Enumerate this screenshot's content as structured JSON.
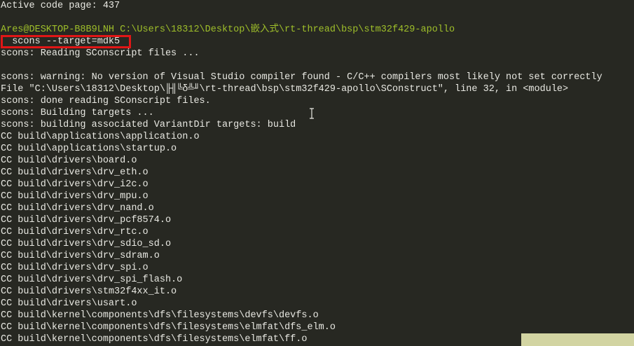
{
  "terminal": {
    "active_code_page": "Active code page: 437",
    "prompt": "Ares@DESKTOP-B8B9LNH C:\\Users\\18312\\Desktop\\嵌入式\\rt-thread\\bsp\\stm32f429-apollo",
    "command": "  scons --target=mdk5",
    "output": [
      "scons: Reading SConscript files ...",
      "scons: warning: No version of Visual Studio compiler found - C/C++ compilers most likely not set correctly",
      "File \"C:\\Users\\18312\\Desktop\\╟╢╚δ╩╜\\rt-thread\\bsp\\stm32f429-apollo\\SConstruct\", line 32, in <module>",
      "scons: done reading SConscript files.",
      "scons: Building targets ...",
      "scons: building associated VariantDir targets: build",
      "CC build\\applications\\application.o",
      "CC build\\applications\\startup.o",
      "CC build\\drivers\\board.o",
      "CC build\\drivers\\drv_eth.o",
      "CC build\\drivers\\drv_i2c.o",
      "CC build\\drivers\\drv_mpu.o",
      "CC build\\drivers\\drv_nand.o",
      "CC build\\drivers\\drv_pcf8574.o",
      "CC build\\drivers\\drv_rtc.o",
      "CC build\\drivers\\drv_sdio_sd.o",
      "CC build\\drivers\\drv_sdram.o",
      "CC build\\drivers\\drv_spi.o",
      "CC build\\drivers\\drv_spi_flash.o",
      "CC build\\drivers\\stm32f4xx_it.o",
      "CC build\\drivers\\usart.o",
      "CC build\\kernel\\components\\dfs\\filesystems\\devfs\\devfs.o",
      "CC build\\kernel\\components\\dfs\\filesystems\\elmfat\\dfs_elm.o",
      "CC build\\kernel\\components\\dfs\\filesystems\\elmfat\\ff.o"
    ]
  },
  "colors": {
    "background": "#272822",
    "text": "#e8e8e2",
    "prompt": "#9fbf2a",
    "highlight": "#e01616"
  },
  "icons": {
    "cursor": "text-cursor-icon"
  }
}
